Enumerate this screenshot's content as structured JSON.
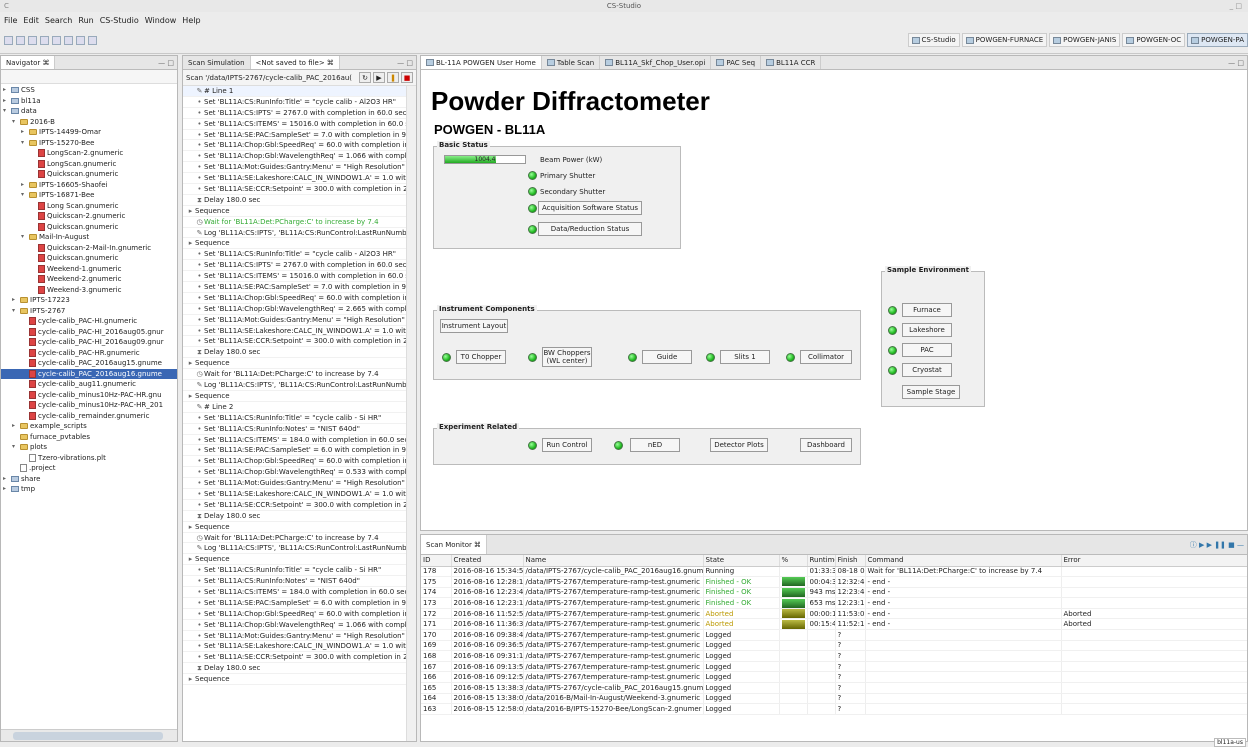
{
  "window": {
    "app_icon": "C",
    "title": "CS-Studio",
    "controls": "_ □"
  },
  "menu": [
    "File",
    "Edit",
    "Search",
    "Run",
    "CS-Studio",
    "Window",
    "Help"
  ],
  "perspectives": [
    "CS-Studio",
    "POWGEN-FURNACE",
    "POWGEN-JANIS",
    "POWGEN-OC",
    "POWGEN-PA"
  ],
  "navigator": {
    "tab": "Navigator ⌘",
    "tree": [
      {
        "d": 0,
        "t": "▸",
        "i": "p",
        "l": "CSS"
      },
      {
        "d": 0,
        "t": "▸",
        "i": "p",
        "l": "bl11a"
      },
      {
        "d": 0,
        "t": "▾",
        "i": "p",
        "l": "data"
      },
      {
        "d": 1,
        "t": "▾",
        "i": "f",
        "l": "2016-B"
      },
      {
        "d": 2,
        "t": "▸",
        "i": "f",
        "l": "IPTS-14499-Omar"
      },
      {
        "d": 2,
        "t": "▾",
        "i": "f",
        "l": "IPTS-15270-Bee"
      },
      {
        "d": 3,
        "t": "",
        "i": "g",
        "l": "LongScan-2.gnumeric"
      },
      {
        "d": 3,
        "t": "",
        "i": "g",
        "l": "LongScan.gnumeric"
      },
      {
        "d": 3,
        "t": "",
        "i": "g",
        "l": "Quickscan.gnumeric"
      },
      {
        "d": 2,
        "t": "▸",
        "i": "f",
        "l": "IPTS-16605-Shaofei"
      },
      {
        "d": 2,
        "t": "▾",
        "i": "f",
        "l": "IPTS-16871-Bee"
      },
      {
        "d": 3,
        "t": "",
        "i": "g",
        "l": "Long Scan.gnumeric"
      },
      {
        "d": 3,
        "t": "",
        "i": "g",
        "l": "Quickscan-2.gnumeric"
      },
      {
        "d": 3,
        "t": "",
        "i": "g",
        "l": "Quickscan.gnumeric"
      },
      {
        "d": 2,
        "t": "▾",
        "i": "f",
        "l": "Mail-In-August"
      },
      {
        "d": 3,
        "t": "",
        "i": "g",
        "l": "Quickscan-2-Mail-In.gnumeric"
      },
      {
        "d": 3,
        "t": "",
        "i": "g",
        "l": "Quickscan.gnumeric"
      },
      {
        "d": 3,
        "t": "",
        "i": "g",
        "l": "Weekend-1.gnumeric"
      },
      {
        "d": 3,
        "t": "",
        "i": "g",
        "l": "Weekend-2.gnumeric"
      },
      {
        "d": 3,
        "t": "",
        "i": "g",
        "l": "Weekend-3.gnumeric"
      },
      {
        "d": 1,
        "t": "▸",
        "i": "f",
        "l": "IPTS-17223"
      },
      {
        "d": 1,
        "t": "▾",
        "i": "f",
        "l": "IPTS-2767"
      },
      {
        "d": 2,
        "t": "",
        "i": "g",
        "l": "cycle-calib_PAC-HI.gnumeric"
      },
      {
        "d": 2,
        "t": "",
        "i": "g",
        "l": "cycle-calib_PAC-HI_2016aug05.gnur"
      },
      {
        "d": 2,
        "t": "",
        "i": "g",
        "l": "cycle-calib_PAC-HI_2016aug09.gnur"
      },
      {
        "d": 2,
        "t": "",
        "i": "g",
        "l": "cycle-calib_PAC-HR.gnumeric"
      },
      {
        "d": 2,
        "t": "",
        "i": "g",
        "l": "cycle-calib_PAC_2016aug15.gnume"
      },
      {
        "d": 2,
        "t": "",
        "i": "g",
        "l": "cycle-calib_PAC_2016aug16.gnume",
        "sel": true
      },
      {
        "d": 2,
        "t": "",
        "i": "g",
        "l": "cycle-calib_aug11.gnumeric"
      },
      {
        "d": 2,
        "t": "",
        "i": "g",
        "l": "cycle-calib_minus10Hz-PAC-HR.gnu"
      },
      {
        "d": 2,
        "t": "",
        "i": "g",
        "l": "cycle-calib_minus10Hz-PAC-HR_201"
      },
      {
        "d": 2,
        "t": "",
        "i": "g",
        "l": "cycle-calib_remainder.gnumeric"
      },
      {
        "d": 1,
        "t": "▸",
        "i": "f",
        "l": "example_scripts"
      },
      {
        "d": 1,
        "t": "",
        "i": "f",
        "l": "furnace_pvtables"
      },
      {
        "d": 1,
        "t": "▾",
        "i": "f",
        "l": "plots"
      },
      {
        "d": 2,
        "t": "",
        "i": "x",
        "l": "Tzero-vibrations.plt"
      },
      {
        "d": 1,
        "t": "",
        "i": "x",
        "l": ".project"
      },
      {
        "d": 0,
        "t": "▸",
        "i": "p",
        "l": "share"
      },
      {
        "d": 0,
        "t": "▸",
        "i": "p",
        "l": "tmp"
      }
    ]
  },
  "scan": {
    "tab1": "Scan Simulation",
    "tab2": "<Not saved to file>",
    "header": "Scan '/data/IPTS-2767/cycle-calib_PAC_2016au(",
    "rows": [
      {
        "i": "✎",
        "l": "# Line 1",
        "d": 1
      },
      {
        "i": "•",
        "l": "Set 'BL11A:CS:RunInfo:Title' = \"cycle calib - Al2O3 HR\"",
        "d": 1
      },
      {
        "i": "•",
        "l": "Set 'BL11A:CS:IPTS' = 2767.0 with completion in 60.0 sec",
        "d": 1
      },
      {
        "i": "•",
        "l": "Set 'BL11A:CS:ITEMS' = 15016.0 with completion in 60.0 s",
        "d": 1
      },
      {
        "i": "•",
        "l": "Set 'BL11A:SE:PAC:SampleSet' = 7.0 with completion in 9",
        "d": 1
      },
      {
        "i": "•",
        "l": "Set 'BL11A:Chop:Gbl:SpeedReq' = 60.0 with completion in",
        "d": 1
      },
      {
        "i": "•",
        "l": "Set 'BL11A:Chop:Gbl:WavelengthReq' = 1.066 with compl",
        "d": 1
      },
      {
        "i": "•",
        "l": "Set 'BL11A:Mot:Guides:Gantry:Menu' = \"High Resolution\"",
        "d": 1
      },
      {
        "i": "•",
        "l": "Set 'BL11A:SE:Lakeshore:CALC_IN_WINDOW1.A' = 1.0 wit",
        "d": 1
      },
      {
        "i": "•",
        "l": "Set 'BL11A:SE:CCR:Setpoint' = 300.0 with completion in 2",
        "d": 1
      },
      {
        "i": "⧗",
        "l": "Delay 180.0 sec",
        "d": 1
      },
      {
        "i": "▸",
        "l": "Sequence",
        "d": 0
      },
      {
        "i": "◷",
        "l": "Wait for 'BL11A:Det:PCharge:C' to increase by 7.4",
        "d": 1,
        "w": true
      },
      {
        "i": "✎",
        "l": "Log 'BL11A:CS:IPTS', 'BL11A:CS:RunControl:LastRunNumb",
        "d": 1
      },
      {
        "i": "▸",
        "l": "Sequence",
        "d": 0
      },
      {
        "i": "•",
        "l": "Set 'BL11A:CS:RunInfo:Title' = \"cycle calib - Al2O3 HR\"",
        "d": 1
      },
      {
        "i": "•",
        "l": "Set 'BL11A:CS:IPTS' = 2767.0 with completion in 60.0 sec",
        "d": 1
      },
      {
        "i": "•",
        "l": "Set 'BL11A:CS:ITEMS' = 15016.0 with completion in 60.0 s",
        "d": 1
      },
      {
        "i": "•",
        "l": "Set 'BL11A:SE:PAC:SampleSet' = 7.0 with completion in 9",
        "d": 1
      },
      {
        "i": "•",
        "l": "Set 'BL11A:Chop:Gbl:SpeedReq' = 60.0 with completion in",
        "d": 1
      },
      {
        "i": "•",
        "l": "Set 'BL11A:Chop:Gbl:WavelengthReq' = 2.665 with compl",
        "d": 1
      },
      {
        "i": "•",
        "l": "Set 'BL11A:Mot:Guides:Gantry:Menu' = \"High Resolution\"",
        "d": 1
      },
      {
        "i": "•",
        "l": "Set 'BL11A:SE:Lakeshore:CALC_IN_WINDOW1.A' = 1.0 wit",
        "d": 1
      },
      {
        "i": "•",
        "l": "Set 'BL11A:SE:CCR:Setpoint' = 300.0 with completion in 2",
        "d": 1
      },
      {
        "i": "⧗",
        "l": "Delay 180.0 sec",
        "d": 1
      },
      {
        "i": "▸",
        "l": "Sequence",
        "d": 0
      },
      {
        "i": "◷",
        "l": "Wait for 'BL11A:Det:PCharge:C' to increase by 7.4",
        "d": 1
      },
      {
        "i": "✎",
        "l": "Log 'BL11A:CS:IPTS', 'BL11A:CS:RunControl:LastRunNumb",
        "d": 1
      },
      {
        "i": "▸",
        "l": "Sequence",
        "d": 0
      },
      {
        "i": "✎",
        "l": "# Line 2",
        "d": 1
      },
      {
        "i": "•",
        "l": "Set 'BL11A:CS:RunInfo:Title' = \"cycle calib - Si HR\"",
        "d": 1
      },
      {
        "i": "•",
        "l": "Set 'BL11A:CS:RunInfo:Notes' = \"NIST 640d\"",
        "d": 1
      },
      {
        "i": "•",
        "l": "Set 'BL11A:CS:ITEMS' = 184.0 with completion in 60.0 sec",
        "d": 1
      },
      {
        "i": "•",
        "l": "Set 'BL11A:SE:PAC:SampleSet' = 6.0 with completion in 9",
        "d": 1
      },
      {
        "i": "•",
        "l": "Set 'BL11A:Chop:Gbl:SpeedReq' = 60.0 with completion in",
        "d": 1
      },
      {
        "i": "•",
        "l": "Set 'BL11A:Chop:Gbl:WavelengthReq' = 0.533 with compl",
        "d": 1
      },
      {
        "i": "•",
        "l": "Set 'BL11A:Mot:Guides:Gantry:Menu' = \"High Resolution\"",
        "d": 1
      },
      {
        "i": "•",
        "l": "Set 'BL11A:SE:Lakeshore:CALC_IN_WINDOW1.A' = 1.0 wit",
        "d": 1
      },
      {
        "i": "•",
        "l": "Set 'BL11A:SE:CCR:Setpoint' = 300.0 with completion in 2",
        "d": 1
      },
      {
        "i": "⧗",
        "l": "Delay 180.0 sec",
        "d": 1
      },
      {
        "i": "▸",
        "l": "Sequence",
        "d": 0
      },
      {
        "i": "◷",
        "l": "Wait for 'BL11A:Det:PCharge:C' to increase by 7.4",
        "d": 1
      },
      {
        "i": "✎",
        "l": "Log 'BL11A:CS:IPTS', 'BL11A:CS:RunControl:LastRunNumb",
        "d": 1
      },
      {
        "i": "▸",
        "l": "Sequence",
        "d": 0
      },
      {
        "i": "•",
        "l": "Set 'BL11A:CS:RunInfo:Title' = \"cycle calib - Si HR\"",
        "d": 1
      },
      {
        "i": "•",
        "l": "Set 'BL11A:CS:RunInfo:Notes' = \"NIST 640d\"",
        "d": 1
      },
      {
        "i": "•",
        "l": "Set 'BL11A:CS:ITEMS' = 184.0 with completion in 60.0 sec",
        "d": 1
      },
      {
        "i": "•",
        "l": "Set 'BL11A:SE:PAC:SampleSet' = 6.0 with completion in 9",
        "d": 1
      },
      {
        "i": "•",
        "l": "Set 'BL11A:Chop:Gbl:SpeedReq' = 60.0 with completion in",
        "d": 1
      },
      {
        "i": "•",
        "l": "Set 'BL11A:Chop:Gbl:WavelengthReq' = 1.066 with compl",
        "d": 1
      },
      {
        "i": "•",
        "l": "Set 'BL11A:Mot:Guides:Gantry:Menu' = \"High Resolution\"",
        "d": 1
      },
      {
        "i": "•",
        "l": "Set 'BL11A:SE:Lakeshore:CALC_IN_WINDOW1.A' = 1.0 wit",
        "d": 1
      },
      {
        "i": "•",
        "l": "Set 'BL11A:SE:CCR:Setpoint' = 300.0 with completion in 2",
        "d": 1
      },
      {
        "i": "⧗",
        "l": "Delay 180.0 sec",
        "d": 1
      },
      {
        "i": "▸",
        "l": "Sequence",
        "d": 0
      }
    ]
  },
  "editor": {
    "tabs": [
      "BL-11A POWGEN User Home",
      "Table Scan",
      "BL11A_Skf_Chop_User.opi",
      "PAC Seq",
      "BL11A CCR"
    ],
    "title": "Powder Diffractometer",
    "subtitle": "POWGEN - BL11A",
    "basic": {
      "title": "Basic Status",
      "beam_value": "1004.4",
      "beam_fraction": 0.64,
      "beam_label": "Beam Power (kW)",
      "primary": "Primary Shutter",
      "secondary": "Secondary Shutter",
      "acq": "Acquisition Software Status",
      "data": "Data/Reduction Status"
    },
    "instrument": {
      "title": "Instrument Components",
      "layout": "Instrument Layout",
      "t0": "T0 Chopper",
      "bw": "BW Choppers",
      "bw2": "(WL center)",
      "guide": "Guide",
      "slits": "Slits 1",
      "coll": "Collimator"
    },
    "sample": {
      "title": "Sample Environment",
      "furnace": "Furnace",
      "lakeshore": "Lakeshore",
      "pac": "PAC",
      "cryostat": "Cryostat",
      "stage": "Sample Stage"
    },
    "experiment": {
      "title": "Experiment Related",
      "run": "Run Control",
      "ned": "nED",
      "det": "Detector Plots",
      "dash": "Dashboard"
    }
  },
  "monitor": {
    "tab": "Scan Monitor",
    "headers": [
      "ID",
      "Created",
      "Name",
      "State",
      "%",
      "Runtime",
      "Finish",
      "Command",
      "Error"
    ],
    "rows": [
      [
        "178",
        "2016-08-16 15:34:5",
        "/data/IPTS-2767/cycle-calib_PAC_2016aug16.gnum",
        "Running",
        "",
        "01:33:3",
        "08-18 0",
        "Wait for 'BL11A:Det:PCharge:C' to increase by 7.4",
        ""
      ],
      [
        "175",
        "2016-08-16 12:28:1",
        "/data/IPTS-2767/temperature-ramp-test.gnumeric",
        "Finished - OK",
        "1",
        "00:04:3",
        "12:32:4",
        "- end -",
        ""
      ],
      [
        "174",
        "2016-08-16 12:23:4",
        "/data/IPTS-2767/temperature-ramp-test.gnumeric",
        "Finished - OK",
        "1",
        "943 ms",
        "12:23:4",
        "- end -",
        ""
      ],
      [
        "173",
        "2016-08-16 12:23:1",
        "/data/IPTS-2767/temperature-ramp-test.gnumeric",
        "Finished - OK",
        "1",
        "653 ms",
        "12:23:1",
        "- end -",
        ""
      ],
      [
        "172",
        "2016-08-16 11:52:5",
        "/data/IPTS-2767/temperature-ramp-test.gnumeric",
        "Aborted",
        "1",
        "00:00:1",
        "11:53:0",
        "- end -",
        "Aborted"
      ],
      [
        "171",
        "2016-08-16 11:36:3",
        "/data/IPTS-2767/temperature-ramp-test.gnumeric",
        "Aborted",
        "1",
        "00:15:4",
        "11:52:1",
        "- end -",
        "Aborted"
      ],
      [
        "170",
        "2016-08-16 09:38:4",
        "/data/IPTS-2767/temperature-ramp-test.gnumeric",
        "Logged",
        "",
        "",
        "?",
        "",
        ""
      ],
      [
        "169",
        "2016-08-16 09:36:5",
        "/data/IPTS-2767/temperature-ramp-test.gnumeric",
        "Logged",
        "",
        "",
        "?",
        "",
        ""
      ],
      [
        "168",
        "2016-08-16 09:31:1",
        "/data/IPTS-2767/temperature-ramp-test.gnumeric",
        "Logged",
        "",
        "",
        "?",
        "",
        ""
      ],
      [
        "167",
        "2016-08-16 09:13:5",
        "/data/IPTS-2767/temperature-ramp-test.gnumeric",
        "Logged",
        "",
        "",
        "?",
        "",
        ""
      ],
      [
        "166",
        "2016-08-16 09:12:5",
        "/data/IPTS-2767/temperature-ramp-test.gnumeric",
        "Logged",
        "",
        "",
        "?",
        "",
        ""
      ],
      [
        "165",
        "2016-08-15 13:38:3",
        "/data/IPTS-2767/cycle-calib_PAC_2016aug15.gnum",
        "Logged",
        "",
        "",
        "?",
        "",
        ""
      ],
      [
        "164",
        "2016-08-15 13:38:0",
        "/data/2016-B/Mail-In-August/Weekend-3.gnumeric",
        "Logged",
        "",
        "",
        "?",
        "",
        ""
      ],
      [
        "163",
        "2016-08-15 12:58:0",
        "/data/2016-B/IPTS-15270-Bee/LongScan-2.gnumer",
        "Logged",
        "",
        "",
        "?",
        "",
        ""
      ]
    ]
  },
  "status": {
    "right": "bl11a-us"
  }
}
